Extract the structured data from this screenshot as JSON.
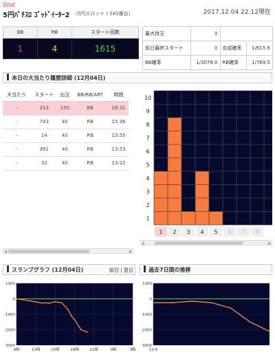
{
  "header": {
    "logo": "Slot",
    "machine_name": "5円ﾊﾟﾁｽﾛ ｺﾞｯﾄﾞｲｰﾀｰ2",
    "machine_sub": "(5円スロット ( 583番台)",
    "datetime": "2017.12.04 22:12現在"
  },
  "counters": {
    "headers": [
      "BB",
      "RB",
      "スタート回数"
    ],
    "bb": "1",
    "rb": "4",
    "start": "1615",
    "colors": {
      "bb": "#ff3b3b",
      "rb": "#f0d800",
      "start": "#3ddb3d"
    }
  },
  "stats": {
    "max_coins_label": "最大持玉",
    "max_coins": "0",
    "prev_start_label": "前日最終スタート",
    "prev_start": "0",
    "combined_label": "合成確率",
    "combined": "1/615.6",
    "bb_prob_label": "BB確率",
    "bb_prob": "1/3078.0",
    "rb_prob_label": "RB確率",
    "rb_prob": "1/769.5"
  },
  "history": {
    "title": "本日の大当たり履歴詳細 (12月04日)",
    "columns": [
      "大当たり",
      "スタート",
      "出玉",
      "BB/RB/ART",
      "時間"
    ],
    "rows": [
      [
        "-",
        "313",
        "150",
        "BB",
        "16:31"
      ],
      [
        "-",
        "743",
        "40",
        "RB",
        "15:36"
      ],
      [
        "-",
        "14",
        "40",
        "RB",
        "13:55"
      ],
      [
        "-",
        "361",
        "40",
        "RB",
        "13:53"
      ],
      [
        "-",
        "32",
        "40",
        "RB",
        "13:22"
      ]
    ]
  },
  "bar_chart": {
    "y_labels": [
      "10",
      "9",
      "8",
      "7",
      "6",
      "5",
      "4",
      "3",
      "2",
      "1"
    ],
    "x_labels": [
      "1",
      "2",
      "3",
      "4",
      "5",
      "6",
      "7",
      "8"
    ],
    "heights": [
      4,
      8,
      1,
      4,
      1,
      0,
      0,
      0,
      0
    ],
    "bar_color": "#f97b3d",
    "bg_color": "#06092e"
  },
  "slump": {
    "title": "スランプグラフ (12月04日)",
    "nav_prev": "前日",
    "nav_sep": "|",
    "nav_next": "翌日",
    "y_ticks": [
      "1000",
      "0",
      "-1000",
      "-2000",
      "-3000"
    ],
    "x_ticks": [
      "9時",
      "12時",
      "15時",
      "18時",
      "21時",
      "0時",
      "3時"
    ],
    "chart_data": {
      "type": "line",
      "x_hours": [
        9,
        10,
        11,
        12,
        13,
        13.5,
        14,
        15,
        15.5,
        16,
        17,
        17.5,
        18,
        19,
        20
      ],
      "y": [
        0,
        -60,
        -130,
        -200,
        -280,
        -250,
        -290,
        -180,
        -230,
        -250,
        -700,
        -1100,
        -1350,
        -2000,
        -2150
      ],
      "ylim": [
        -3000,
        1000
      ]
    }
  },
  "weekly": {
    "title": "過去7日間の推移",
    "y_ticks": [
      "1000",
      "0",
      "-1000",
      "-2000",
      "-3000"
    ],
    "x_ticks": [
      "12/4"
    ],
    "chart_data": {
      "type": "line",
      "x_index": [
        0,
        1,
        2,
        3,
        4,
        5,
        6
      ],
      "y": [
        -250,
        -250,
        -150,
        -250,
        -600,
        -1500,
        -2100
      ],
      "ylim": [
        -3000,
        1000
      ]
    }
  }
}
